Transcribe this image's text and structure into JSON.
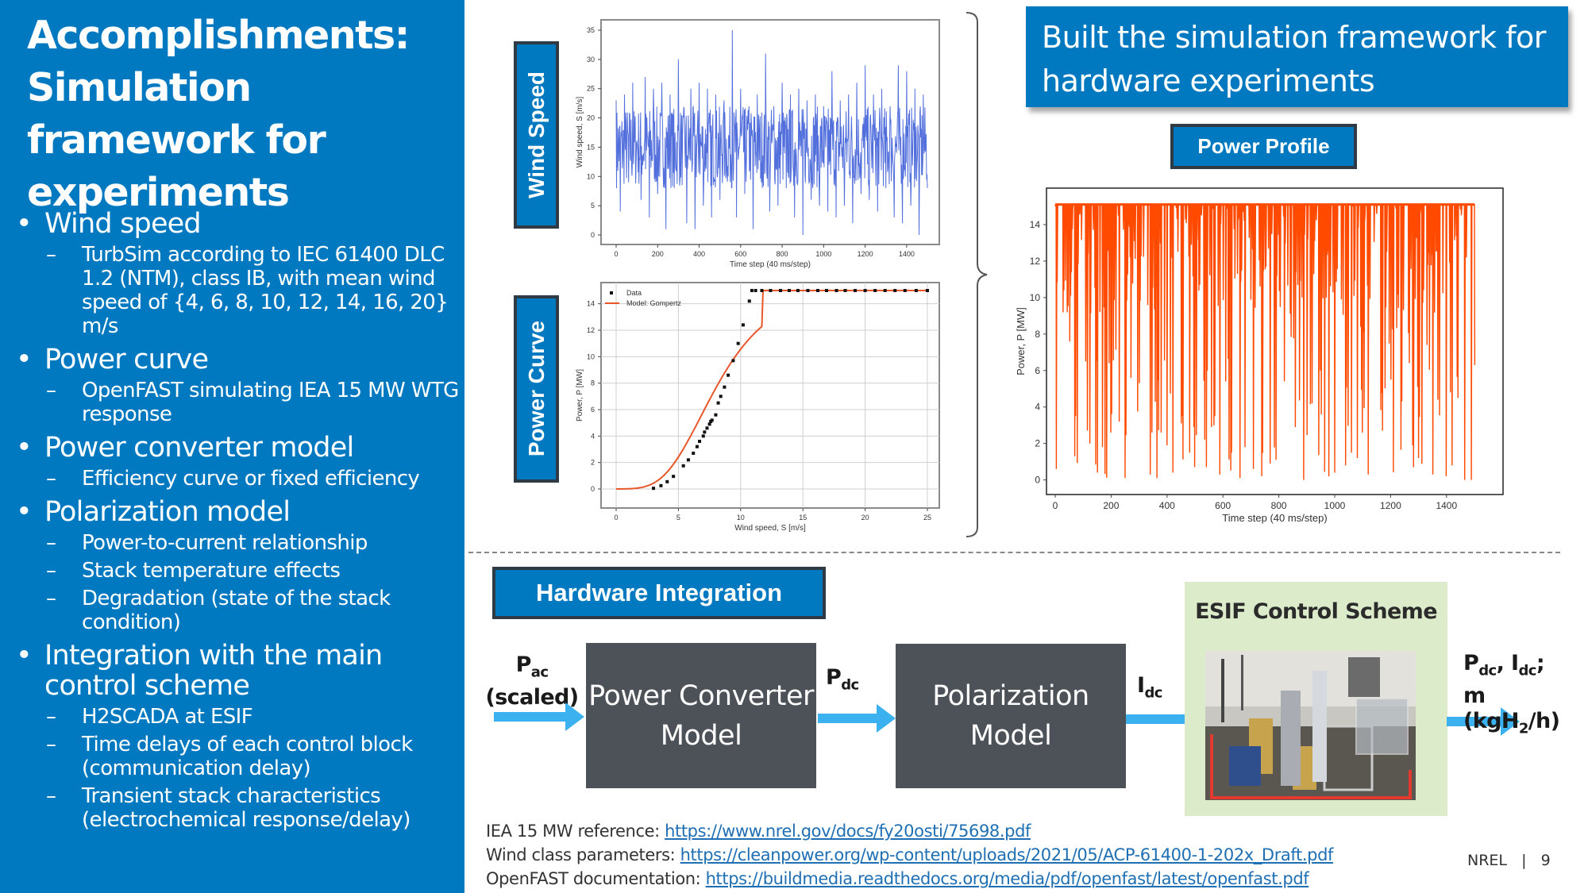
{
  "slide": {
    "title": "Accomplishments: Simulation framework for experiments",
    "page_org": "NREL",
    "page_separator": "|",
    "page_number": "9"
  },
  "bullets": [
    {
      "text": "Wind speed",
      "sub": [
        "TurbSim according to IEC 61400 DLC 1.2 (NTM), class IB, with mean wind speed of {4, 6, 8, 10, 12, 14, 16, 20} m/s"
      ]
    },
    {
      "text": "Power curve",
      "sub": [
        "OpenFAST simulating IEA 15 MW WTG response"
      ]
    },
    {
      "text": "Power converter model",
      "sub": [
        "Efficiency curve or fixed efficiency"
      ]
    },
    {
      "text": "Polarization model",
      "sub": [
        "Power-to-current relationship",
        "Stack temperature effects",
        "Degradation (state of the stack condition)"
      ]
    },
    {
      "text": "Integration with the main control scheme",
      "sub": [
        "H2SCADA at ESIF",
        "Time delays of each control block (communication delay)",
        "Transient stack characteristics (electrochemical response/delay)"
      ]
    }
  ],
  "labels": {
    "wind_speed": "Wind Speed",
    "power_curve": "Power Curve",
    "power_profile": "Power Profile",
    "hardware_integration": "Hardware Integration",
    "headline": "Built the simulation framework for hardware experiments"
  },
  "diagram": {
    "input_main": "P",
    "input_sub": "ac",
    "input_note": "(scaled)",
    "block1": "Power Converter Model",
    "mid1_main": "P",
    "mid1_sub": "dc",
    "block2": "Polarization Model",
    "mid2_main": "I",
    "mid2_sub": "dc",
    "esif_title": "ESIF Control Scheme",
    "esif_image": "electrolyzer-lab-photo",
    "out_line1_a": "P",
    "out_line1_a_sub": "dc",
    "out_line1_b": ", I",
    "out_line1_b_sub": "dc",
    "out_line1_end": ";",
    "out_line2_a": "m (kgH",
    "out_line2_sub": "2",
    "out_line2_end": "/h)"
  },
  "references": [
    {
      "label": "IEA 15 MW reference: ",
      "link": "https://www.nrel.gov/docs/fy20osti/75698.pdf"
    },
    {
      "label": "Wind class parameters: ",
      "link": "https://cleanpower.org/wp-content/uploads/2021/05/ACP-61400-1-202x_Draft.pdf"
    },
    {
      "label": "OpenFAST documentation: ",
      "link": "https://buildmedia.readthedocs.org/media/pdf/openfast/latest/openfast.pdf"
    }
  ],
  "colors": {
    "brand_blue": "#0079c1",
    "wind_line": "#3f5fd8",
    "power_line": "#ff4a00",
    "model_line": "#e8562a",
    "arrow": "#3cb1ef",
    "block_gray": "#4d5258",
    "esif_green": "#dcebc9"
  },
  "chart_data": [
    {
      "id": "wind",
      "type": "line",
      "title": "",
      "xlabel": "Time step (40 ms/step)",
      "ylabel": "Wind speed, S [m/s]",
      "xlim": [
        0,
        1500
      ],
      "ylim": [
        0,
        35
      ],
      "xticks": [
        0,
        200,
        400,
        600,
        800,
        1000,
        1200,
        1400
      ],
      "yticks": [
        0,
        5,
        10,
        15,
        20,
        25,
        30,
        35
      ],
      "grid": false,
      "series": [
        {
          "name": "Wind speed",
          "description": "turbulent signal, mean ~15 m/s, range ~0–35 m/s, 1500 steps",
          "x": [
            0,
            20,
            40,
            60,
            80,
            100,
            120,
            140,
            160,
            180,
            200,
            220,
            240,
            260,
            280,
            300,
            320,
            340,
            360,
            380,
            400,
            420,
            440,
            460,
            480,
            500,
            520,
            540,
            560,
            580,
            600,
            620,
            640,
            660,
            680,
            700,
            720,
            740,
            760,
            780,
            800,
            820,
            840,
            860,
            880,
            900,
            920,
            940,
            960,
            980,
            1000,
            1020,
            1040,
            1060,
            1080,
            1100,
            1120,
            1140,
            1160,
            1180,
            1200,
            1220,
            1240,
            1260,
            1280,
            1300,
            1320,
            1340,
            1360,
            1380,
            1400,
            1420,
            1440,
            1460,
            1480,
            1500
          ],
          "values": [
            23,
            4,
            24,
            9,
            26,
            16,
            6,
            27,
            3,
            25,
            7,
            26,
            1,
            24,
            8,
            30,
            17,
            2,
            25,
            1,
            26,
            5,
            25,
            3,
            24,
            6,
            23,
            10,
            35,
            3,
            25,
            7,
            22,
            1,
            24,
            9,
            31,
            4,
            22,
            5,
            26,
            8,
            24,
            3,
            25,
            0,
            23,
            6,
            24,
            5,
            22,
            4,
            28,
            3,
            23,
            5,
            24,
            2,
            26,
            7,
            29,
            6,
            24,
            4,
            25,
            8,
            22,
            3,
            29,
            2,
            28,
            5,
            25,
            0,
            24,
            8
          ]
        }
      ]
    },
    {
      "id": "power_curve",
      "type": "scatter",
      "title": "",
      "xlabel": "Wind speed, S [m/s]",
      "ylabel": "Power, P [MW]",
      "xlim": [
        0,
        25
      ],
      "ylim": [
        0,
        15
      ],
      "xticks": [
        0,
        5,
        10,
        15,
        20,
        25
      ],
      "yticks": [
        0,
        2,
        4,
        6,
        8,
        10,
        12,
        14
      ],
      "grid": true,
      "legend": "top-left",
      "series": [
        {
          "name": "Data",
          "marker": "square",
          "x": [
            3,
            3.6,
            4.1,
            4.6,
            5.4,
            5.8,
            6.2,
            6.5,
            6.7,
            7.0,
            7.1,
            7.3,
            7.5,
            7.6,
            7.7,
            8.0,
            8.2,
            8.4,
            8.7,
            9.0,
            9.4,
            9.8,
            10.2,
            10.7,
            10.9,
            11.2,
            11.7,
            12.4,
            13.2,
            13.9,
            14.6,
            15.4,
            16.2,
            16.9,
            17.7,
            18.4,
            19.2,
            20.0,
            20.8,
            21.6,
            22.4,
            23.2,
            24.1,
            25.0
          ],
          "y": [
            0.05,
            0.25,
            0.55,
            0.95,
            1.75,
            2.2,
            2.7,
            3.2,
            3.6,
            4.0,
            4.3,
            4.6,
            4.9,
            5.1,
            5.2,
            5.6,
            6.5,
            7.0,
            7.7,
            8.6,
            9.7,
            11.0,
            12.4,
            14.2,
            15.0,
            15.0,
            15.0,
            15.0,
            15.0,
            15.0,
            15.0,
            15.0,
            15.0,
            15.0,
            15.0,
            15.0,
            15.0,
            15.0,
            15.0,
            15.0,
            15.0,
            15.0,
            15.0,
            15.0
          ]
        },
        {
          "name": "Model: Gompertz",
          "type": "line",
          "description": "sigmoid fit saturating at 15 MW near 11.7 m/s"
        }
      ]
    },
    {
      "id": "power_profile",
      "type": "line",
      "title": "",
      "xlabel": "Time step (40 ms/step)",
      "ylabel": "Power, P [MW]",
      "xlim": [
        0,
        1500
      ],
      "ylim": [
        0,
        15
      ],
      "xticks": [
        0,
        200,
        400,
        600,
        800,
        1000,
        1200,
        1400
      ],
      "yticks": [
        0,
        2,
        4,
        6,
        8,
        10,
        12,
        14
      ],
      "grid": false,
      "series": [
        {
          "name": "Power",
          "description": "mostly rated 15 MW with frequent dips toward 0 MW",
          "x": [
            0,
            5,
            30,
            70,
            110,
            125,
            150,
            170,
            200,
            230,
            250,
            270,
            300,
            340,
            365,
            380,
            400,
            420,
            450,
            480,
            500,
            540,
            570,
            590,
            610,
            630,
            660,
            680,
            710,
            740,
            770,
            790,
            820,
            860,
            890,
            920,
            950,
            980,
            1000,
            1040,
            1060,
            1080,
            1100,
            1120,
            1170,
            1200,
            1240,
            1280,
            1300,
            1330,
            1350,
            1370,
            1400,
            1420,
            1440,
            1465,
            1490,
            1500
          ],
          "values": [
            15,
            0.6,
            10.4,
            1.3,
            6.5,
            2,
            0.4,
            1.8,
            2.6,
            3.2,
            0.1,
            5.6,
            5.3,
            0.3,
            0.1,
            2.6,
            1.9,
            0.4,
            3.1,
            1.5,
            0.7,
            0.7,
            3.5,
            0.3,
            5.4,
            1.5,
            0.1,
            1.8,
            0.6,
            0.2,
            0.9,
            1.1,
            5.4,
            2.9,
            0,
            4.2,
            6,
            0.2,
            0.4,
            0.8,
            1.5,
            1.2,
            2.6,
            0.3,
            2.7,
            5.5,
            4.3,
            1.9,
            1.2,
            7.4,
            0.3,
            4.4,
            0.2,
            0.8,
            4.5,
            0,
            0,
            6.3
          ]
        }
      ]
    }
  ]
}
